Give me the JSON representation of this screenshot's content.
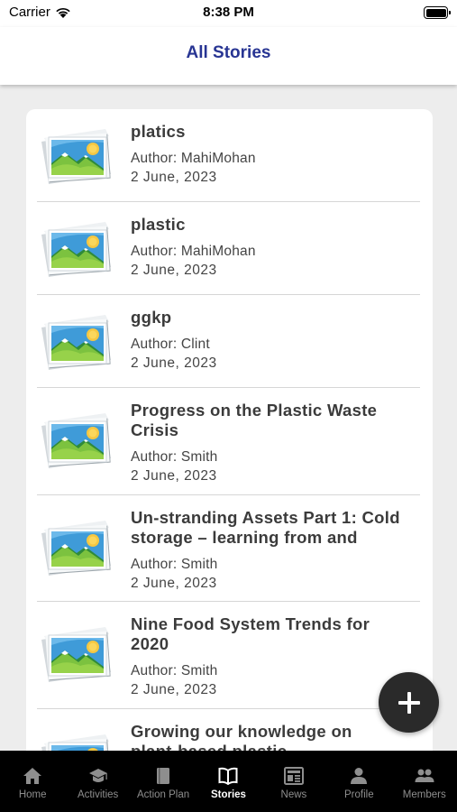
{
  "status_bar": {
    "carrier": "Carrier",
    "time": "8:38 PM"
  },
  "header": {
    "title": "All Stories"
  },
  "stories": [
    {
      "title": "platics",
      "author": "Author: MahiMohan",
      "date": "2  June,  2023"
    },
    {
      "title": "plastic",
      "author": "Author: MahiMohan",
      "date": "2  June,  2023"
    },
    {
      "title": "ggkp",
      "author": "Author: Clint",
      "date": "2  June,  2023"
    },
    {
      "title_lines": [
        "Progress on the Plastic Waste",
        "Crisis"
      ],
      "author": "Author: Smith",
      "date": "2  June,  2023"
    },
    {
      "title_lines": [
        "Un-stranding Assets Part 1: Cold",
        "storage – learning from and"
      ],
      "author": "Author: Smith",
      "date": "2  June,  2023"
    },
    {
      "title_lines": [
        "Nine Food System Trends for",
        "2020"
      ],
      "author": "Author: Smith",
      "date": "2  June,  2023"
    },
    {
      "title_lines": [
        "Growing our knowledge on",
        "plant-based plastic"
      ]
    }
  ],
  "fab": {
    "icon": "plus-icon"
  },
  "tabs": [
    {
      "label": "Home",
      "icon": "home-icon",
      "active": false
    },
    {
      "label": "Activities",
      "icon": "graduation-cap-icon",
      "active": false
    },
    {
      "label": "Action Plan",
      "icon": "book-icon",
      "active": false
    },
    {
      "label": "Stories",
      "icon": "open-book-icon",
      "active": true
    },
    {
      "label": "News",
      "icon": "newspaper-icon",
      "active": false
    },
    {
      "label": "Profile",
      "icon": "person-icon",
      "active": false
    },
    {
      "label": "Members",
      "icon": "people-icon",
      "active": false
    }
  ],
  "colors": {
    "title_accent": "#283593",
    "tab_active": "#ffffff",
    "tab_inactive": "#8e8e8e",
    "fab": "#2a2a2a"
  }
}
